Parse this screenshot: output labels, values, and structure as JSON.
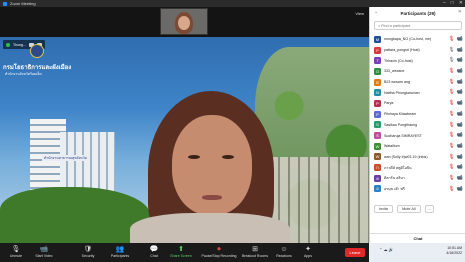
{
  "window": {
    "title": "Zoom Meeting"
  },
  "top": {
    "view_label": "View"
  },
  "shared_screen": {
    "sharer_label": "Thong...",
    "logo_text": "กรมโยธาธิการและผังเมือง",
    "logo_subtext": "สำนักงานจังหวัดร้อยเอ็ด",
    "building_sign": "สำนักงานสาธารณสุขจังหวัด"
  },
  "toolbar": {
    "items": [
      {
        "icon": "mic-off-icon",
        "glyph": "🎙",
        "label": "Unmute"
      },
      {
        "icon": "video-off-icon",
        "glyph": "📹",
        "label": "Start Video"
      },
      {
        "icon": "shield-icon",
        "glyph": "🛡",
        "label": "Security"
      },
      {
        "icon": "participants-icon",
        "glyph": "👥",
        "label": "Participants"
      },
      {
        "icon": "chat-icon",
        "glyph": "💬",
        "label": "Chat"
      },
      {
        "icon": "share-screen-icon",
        "glyph": "⬆",
        "label": "Share Screen"
      },
      {
        "icon": "record-icon",
        "glyph": "⏺",
        "label": "Pause/Stop Recording"
      },
      {
        "icon": "breakout-icon",
        "glyph": "⊞",
        "label": "Breakout Rooms"
      },
      {
        "icon": "reactions-icon",
        "glyph": "☺",
        "label": "Reactions"
      },
      {
        "icon": "apps-icon",
        "glyph": "✦",
        "label": "Apps"
      }
    ],
    "leave_label": "Leave"
  },
  "panel": {
    "title": "Participants (29)",
    "search_placeholder": "Find a participant",
    "participants": [
      {
        "initial": "M",
        "color": "#1f4f9e",
        "name": "mongkapa_NO (Co-host, me)",
        "mic_on": false
      },
      {
        "initial": "P",
        "color": "#d93b3b",
        "name": "pattara_pongsri (Host)",
        "mic_on": true
      },
      {
        "initial": "T",
        "color": "#7a3fb5",
        "name": "Thiravin (Co-host)",
        "mic_on": true
      },
      {
        "initial": "O",
        "color": "#2f8f3f",
        "name": "333_wexane",
        "mic_on": false
      },
      {
        "initial": "B",
        "color": "#e07b1a",
        "name": "B23 wesarn ang",
        "mic_on": false
      },
      {
        "initial": "N",
        "color": "#1f8fa8",
        "name": "Nattha Phongkanchan",
        "mic_on": false
      },
      {
        "initial": "P",
        "color": "#b7324e",
        "name": "Parya",
        "mic_on": false
      },
      {
        "initial": "P",
        "color": "#5b6bd1",
        "name": "Pitchaya Kliawkeam",
        "mic_on": false
      },
      {
        "initial": "S",
        "color": "#2d9a6a",
        "name": "Sasikan Pongthaung",
        "mic_on": false
      },
      {
        "initial": "S",
        "color": "#c44c9e",
        "name": "Sudharuja SIMRAYEST",
        "mic_on": false
      },
      {
        "initial": "W",
        "color": "#3b8f2c",
        "name": "Watallium",
        "mic_on": false
      },
      {
        "initial": "W",
        "color": "#8a5a2a",
        "name": "wan (Solly #)w03-19 (infos)",
        "mic_on": false
      },
      {
        "initial": "ก",
        "color": "#d14a2a",
        "name": "ภาวดีส์ สตูดิโอปิน",
        "mic_on": false
      },
      {
        "initial": "ด",
        "color": "#6a3fa8",
        "name": "ดิตารัน ลลิบา",
        "mic_on": false
      },
      {
        "initial": "อ",
        "color": "#2f7fbf",
        "name": "อรนุช เอ๊ะ ฟรี",
        "mic_on": false
      }
    ],
    "invite_label": "Invite",
    "mute_all_label": "Mute All",
    "more_label": "...",
    "chat_label": "Chat"
  },
  "taskbar": {
    "time": "10:51 AM",
    "date": "4/16/2022"
  }
}
